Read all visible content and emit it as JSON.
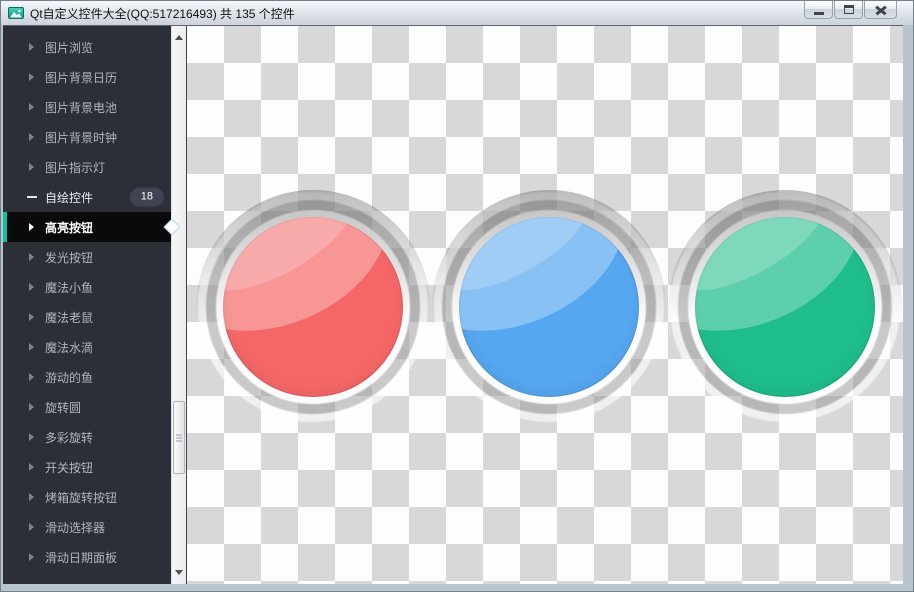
{
  "window": {
    "title": "Qt自定义控件大全(QQ:517216493) 共 135 个控件",
    "icon": "app-image-icon",
    "controls": [
      {
        "name": "minimize"
      },
      {
        "name": "maximize"
      },
      {
        "name": "close"
      }
    ]
  },
  "sidebar": {
    "bg": "#2c2f38",
    "selected_bg": "#0a0a0c",
    "accent_color": "#0dc2a0",
    "items": [
      {
        "label": "图片浏览",
        "state": "collapsed"
      },
      {
        "label": "图片背景日历",
        "state": "collapsed"
      },
      {
        "label": "图片背景电池",
        "state": "collapsed"
      },
      {
        "label": "图片背景时钟",
        "state": "collapsed"
      },
      {
        "label": "图片指示灯",
        "state": "collapsed"
      },
      {
        "label": "自绘控件",
        "state": "expanded",
        "badge": "18"
      },
      {
        "label": "高亮按钮",
        "state": "selected"
      },
      {
        "label": "发光按钮",
        "state": "collapsed"
      },
      {
        "label": "魔法小鱼",
        "state": "collapsed"
      },
      {
        "label": "魔法老鼠",
        "state": "collapsed"
      },
      {
        "label": "魔法水滴",
        "state": "collapsed"
      },
      {
        "label": "游动的鱼",
        "state": "collapsed"
      },
      {
        "label": "旋转圆",
        "state": "collapsed"
      },
      {
        "label": "多彩旋转",
        "state": "collapsed"
      },
      {
        "label": "开关按钮",
        "state": "collapsed"
      },
      {
        "label": "烤箱旋转按钮",
        "state": "collapsed"
      },
      {
        "label": "滑动选择器",
        "state": "collapsed"
      },
      {
        "label": "滑动日期面板",
        "state": "collapsed"
      }
    ]
  },
  "main": {
    "checker": {
      "light": "#fdfdfd",
      "dark": "#d8d8d8"
    },
    "light_buttons": [
      {
        "name": "red-light-button",
        "base": "#f56767",
        "gloss": "rgba(255,255,255,0.30)"
      },
      {
        "name": "blue-light-button",
        "base": "#55a7f0",
        "gloss": "rgba(255,255,255,0.30)"
      },
      {
        "name": "green-light-button",
        "base": "#1fbd8c",
        "gloss": "rgba(255,255,255,0.28)"
      }
    ]
  }
}
